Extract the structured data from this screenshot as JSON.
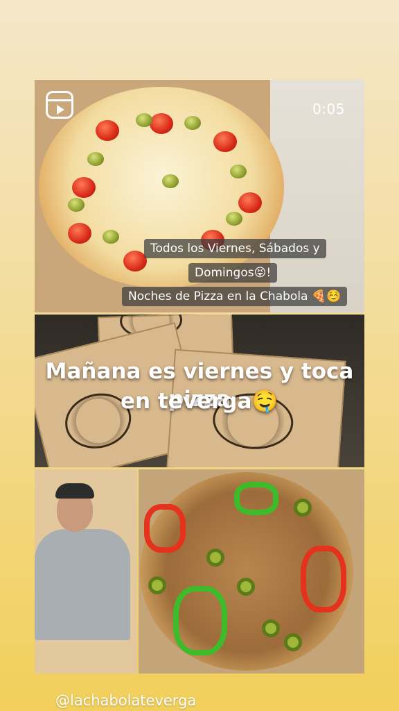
{
  "story": {
    "timer": "0:05",
    "captions": {
      "line1": "Todos los Viernes, Sábados y",
      "line2": "Domingos😝!",
      "line3": "Noches de Pizza en la Chabola 🍕☺️"
    },
    "overlay_text": {
      "line1": "Mañana es viernes y toca pizza",
      "line2": "en teverga🤤"
    },
    "handle": "@lachabolateverga"
  },
  "icons": {
    "reel": "reels-icon"
  }
}
